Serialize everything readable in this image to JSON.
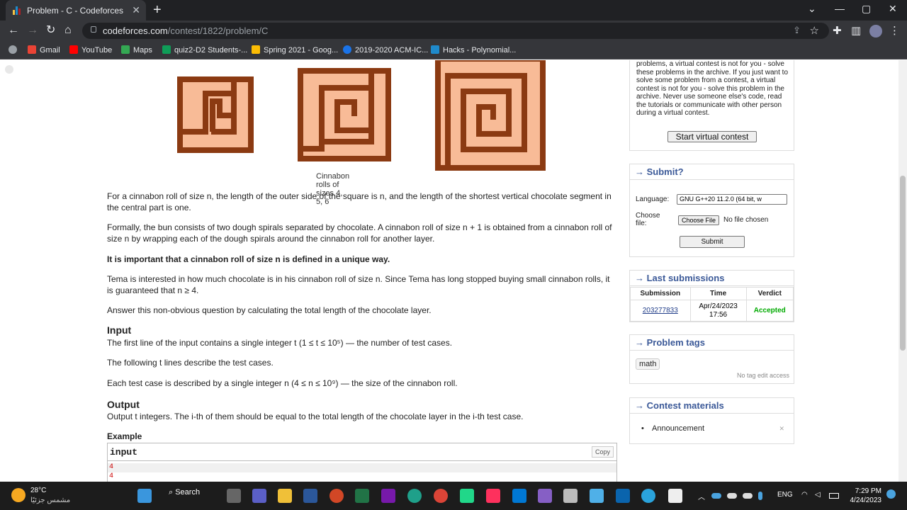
{
  "browser": {
    "tab_title": "Problem - C - Codeforces",
    "tab_close": "✕",
    "new_tab": "+",
    "url_host": "codeforces.com",
    "url_path": "/contest/1822/problem/C",
    "bookmarks": [
      "Gmail",
      "YouTube",
      "Maps",
      "quiz2-D2 Students-...",
      "Spring 2021 - Goog...",
      "2019-2020 ACM-IC...",
      "Hacks - Polynomial..."
    ]
  },
  "problem": {
    "caption": "Cinnabon rolls of sizes 4, 5, 6",
    "p1": "For a cinnabon roll of size n, the length of the outer side of the square is n, and the length of the shortest vertical chocolate segment in the central part is one.",
    "p2": "Formally, the bun consists of two dough spirals separated by chocolate. A cinnabon roll of size n + 1 is obtained from a cinnabon roll of size n by wrapping each of the dough spirals around the cinnabon roll for another layer.",
    "p3": "It is important that a cinnabon roll of size n is defined in a unique way.",
    "p4": "Tema is interested in how much chocolate is in his cinnabon roll of size n. Since Tema has long stopped buying small cinnabon rolls, it is guaranteed that n ≥ 4.",
    "p5": "Answer this non-obvious question by calculating the total length of the chocolate layer.",
    "input_header": "Input",
    "input_p1": "The first line of the input contains a single integer t (1 ≤ t ≤ 10⁵) — the number of test cases.",
    "input_p2": "The following t lines describe the test cases.",
    "input_p3": "Each test case is described by a single integer n (4 ≤ n ≤ 10⁹) — the size of the cinnabon roll.",
    "output_header": "Output",
    "output_p1": "Output t integers. The i-th of them should be equal to the total length of the chocolate layer in the i-th test case.",
    "example_title": "Example",
    "example_input_label": "input",
    "copy_label": "Copy",
    "example_lines": [
      "4",
      "4"
    ]
  },
  "sidebar": {
    "virtual_text": "problems, a virtual contest is not for you - solve these problems in the archive. If you just want to solve some problem from a contest, a virtual contest is not for you - solve this problem in the archive. Never use someone else's code, read the tutorials or communicate with other person during a virtual contest.",
    "start_virtual": "Start virtual contest",
    "submit_title": "→ Submit?",
    "language_label": "Language:",
    "language_value": "GNU G++20 11.2.0 (64 bit, w",
    "choose_file_label": "Choose file:",
    "choose_file_btn": "Choose File",
    "no_file": "No file chosen",
    "submit_btn": "Submit",
    "last_title": "→ Last submissions",
    "col_submission": "Submission",
    "col_time": "Time",
    "col_verdict": "Verdict",
    "sub_id": "203277833",
    "sub_date": "Apr/24/2023",
    "sub_time": "17:56",
    "sub_verdict": "Accepted",
    "tags_title": "→ Problem tags",
    "tag": "math",
    "no_tag_edit": "No tag edit access",
    "materials_title": "→ Contest materials",
    "announcement": "Announcement"
  },
  "taskbar": {
    "temp": "28°C",
    "weather": "مشمس جزئيًا",
    "search": "Search",
    "lang": "ENG",
    "time": "7:29 PM",
    "date": "4/24/2023"
  },
  "colors": {
    "dough": "#f8bb97",
    "chocolate": "#8b3a12",
    "accent": "#3b5998",
    "accepted": "#0a0"
  }
}
